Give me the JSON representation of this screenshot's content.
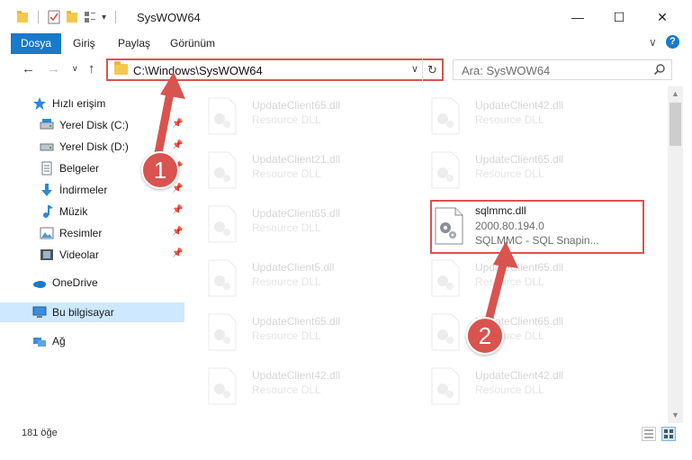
{
  "window": {
    "title": "SysWOW64",
    "minimize_glyph": "—",
    "maximize_glyph": "☐",
    "close_glyph": "✕"
  },
  "ribbon": {
    "tabs": [
      "Dosya",
      "Giriş",
      "Paylaş",
      "Görünüm"
    ],
    "expand_glyph": "∨",
    "help_glyph": "?"
  },
  "address": {
    "path": "C:\\Windows\\SysWOW64",
    "dropdown_glyph": "∨",
    "refresh_glyph": "↻"
  },
  "search": {
    "placeholder": "Ara: SysWOW64"
  },
  "nav": {
    "back_glyph": "←",
    "forward_glyph": "→",
    "recent_glyph": "∨",
    "up_glyph": "↑"
  },
  "sidebar": {
    "quick_access": "Hızlı erişim",
    "items": [
      {
        "label": "Yerel Disk (C:)",
        "icon": "drive-icon"
      },
      {
        "label": "Yerel Disk (D:)",
        "icon": "drive-icon"
      },
      {
        "label": "Belgeler",
        "icon": "documents-icon"
      },
      {
        "label": "İndirmeler",
        "icon": "downloads-icon"
      },
      {
        "label": "Müzik",
        "icon": "music-icon"
      },
      {
        "label": "Resimler",
        "icon": "pictures-icon"
      },
      {
        "label": "Videolar",
        "icon": "videos-icon"
      }
    ],
    "onedrive": "OneDrive",
    "this_pc": "Bu bilgisayar",
    "network": "Ağ"
  },
  "files": [
    {
      "name": "UpdateClient65.dll",
      "desc": "Resource DLL"
    },
    {
      "name": "UpdateClient42.dll",
      "desc": "Resource DLL"
    },
    {
      "name": "UpdateClient21.dll",
      "desc": "Resource DLL"
    },
    {
      "name": "UpdateClient65.dll",
      "desc": "Resource DLL"
    },
    {
      "name": "UpdateClient65.dll",
      "desc": "Resource DLL"
    },
    {
      "name": "sqlmmc.dll",
      "desc": "2000.80.194.0",
      "desc2": "SQLMMC - SQL Snapin..."
    },
    {
      "name": "UpdateClient5.dll",
      "desc": "Resource DLL"
    },
    {
      "name": "UpdateClient65.dll",
      "desc": "Resource DLL"
    },
    {
      "name": "UpdateClient65.dll",
      "desc": "Resource DLL"
    },
    {
      "name": "UpdateClient65.dll",
      "desc": "Resource DLL"
    },
    {
      "name": "UpdateClient42.dll",
      "desc": "Resource DLL"
    },
    {
      "name": "UpdateClient42.dll",
      "desc": "Resource DLL"
    }
  ],
  "status": {
    "count": "181 öğe"
  },
  "annotations": {
    "step1": "1",
    "step2": "2"
  },
  "colors": {
    "accent": "#1979ca",
    "highlight": "#d9534f",
    "selection": "#cde8ff"
  }
}
